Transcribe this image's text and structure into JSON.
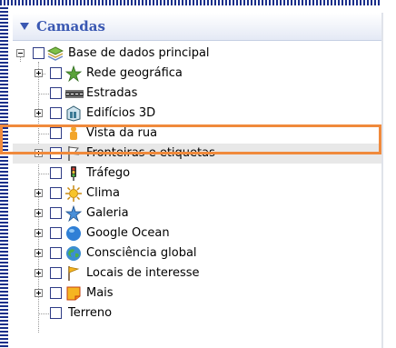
{
  "panel": {
    "title": "Camadas"
  },
  "layers": {
    "root": {
      "label": "Base de dados principal",
      "icon": "layers-stack-icon"
    },
    "items": [
      {
        "label": "Rede geográfica",
        "icon": "star-globe-icon",
        "expandable": true
      },
      {
        "label": "Estradas",
        "icon": "road-icon",
        "expandable": false
      },
      {
        "label": "Edifícios 3D",
        "icon": "building-3d-icon",
        "expandable": true
      },
      {
        "label": "Vista da rua",
        "icon": "street-view-person-icon",
        "expandable": false
      },
      {
        "label": "Fronteiras e etiquetas",
        "icon": "borders-flag-icon",
        "expandable": true
      },
      {
        "label": "Tráfego",
        "icon": "traffic-light-icon",
        "expandable": false
      },
      {
        "label": "Clima",
        "icon": "sun-weather-icon",
        "expandable": true
      },
      {
        "label": "Galeria",
        "icon": "gallery-star-icon",
        "expandable": true
      },
      {
        "label": "Google Ocean",
        "icon": "ocean-globe-icon",
        "expandable": true
      },
      {
        "label": "Consciência global",
        "icon": "global-awareness-globe-icon",
        "expandable": true
      },
      {
        "label": "Locais de interesse",
        "icon": "flag-poi-icon",
        "expandable": true
      },
      {
        "label": "Mais",
        "icon": "more-note-icon",
        "expandable": true
      },
      {
        "label": "Terreno",
        "icon": "",
        "expandable": false
      }
    ]
  },
  "colors": {
    "accent": "#3a58b2",
    "highlight": "#f08a3c",
    "checkbox_border": "#2e3b85"
  }
}
